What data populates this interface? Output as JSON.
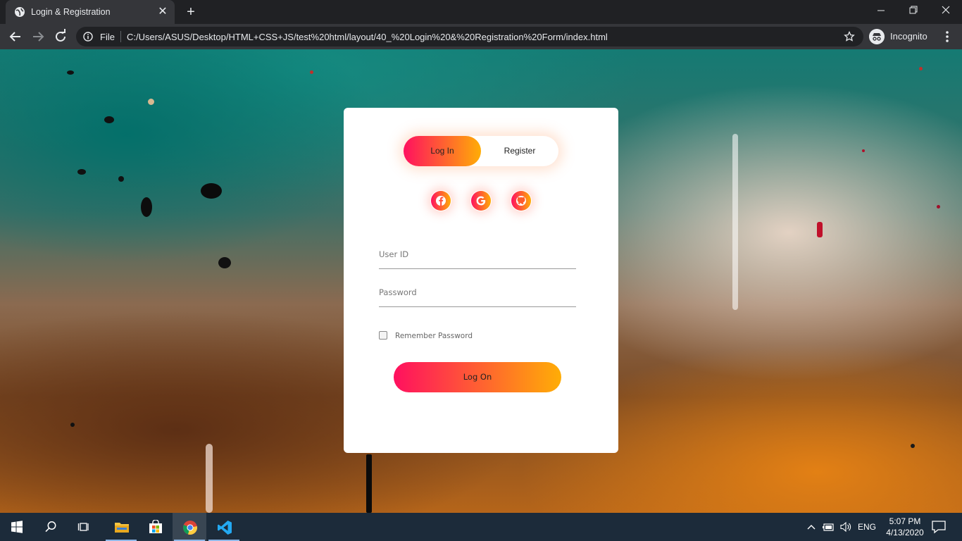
{
  "browser": {
    "tab_title": "Login & Registration",
    "new_tab_label": "+",
    "scheme_label": "File",
    "url": "C:/Users/ASUS/Desktop/HTML+CSS+JS/test%20html/layout/40_%20Login%20&%20Registration%20Form/index.html",
    "profile_label": "Incognito",
    "icons": [
      "globe-icon",
      "close-icon",
      "back-arrow-icon",
      "forward-arrow-icon",
      "reload-icon",
      "info-icon",
      "star-icon",
      "incognito-icon",
      "kebab-menu-icon"
    ]
  },
  "form": {
    "tabs": [
      {
        "label": "Log In",
        "active": true
      },
      {
        "label": "Register",
        "active": false
      }
    ],
    "social": [
      "facebook-icon",
      "google-icon",
      "github-icon"
    ],
    "user_placeholder": "User ID",
    "password_placeholder": "Password",
    "remember_label": "Remember Password",
    "submit_label": "Log On"
  },
  "taskbar": {
    "items": [
      "windows-start-icon",
      "search-icon",
      "task-view-icon",
      "file-explorer-icon",
      "store-icon",
      "chrome-icon",
      "vscode-icon"
    ],
    "language": "ENG",
    "time": "5:07 PM",
    "date": "4/13/2020"
  },
  "colors": {
    "gradient_start": "#ff105f",
    "gradient_end": "#ffad06",
    "chrome_dark": "#202124",
    "taskbar": "#1c2b3a"
  }
}
